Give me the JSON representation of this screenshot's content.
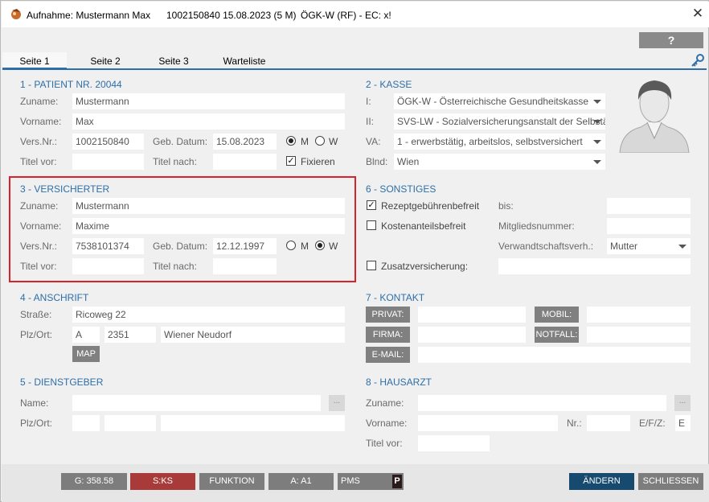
{
  "titlebar": {
    "title": "Aufnahme: Mustermann Max",
    "patient_info": "1002150840 15.08.2023 (5 M)",
    "insurance_info": "ÖGK-W (RF) - EC: x!",
    "close_glyph": "✕"
  },
  "help_label": "?",
  "tabs": [
    "Seite 1",
    "Seite 2",
    "Seite 3",
    "Warteliste"
  ],
  "patient": {
    "heading": "1 - PATIENT NR. 20044",
    "zuname_label": "Zuname:",
    "zuname": "Mustermann",
    "vorname_label": "Vorname:",
    "vorname": "Max",
    "versnr_label": "Vers.Nr.:",
    "versnr": "1002150840",
    "gebdatum_label": "Geb. Datum:",
    "gebdatum": "15.08.2023",
    "m_label": "M",
    "w_label": "W",
    "sex": "M",
    "titelvor_label": "Titel vor:",
    "titelnach_label": "Titel nach:",
    "fixieren_label": "Fixieren",
    "fixieren": true
  },
  "kasse": {
    "heading": "2 - KASSE",
    "i_label": "I:",
    "i_value": "ÖGK-W - Österreichische Gesundheitskasse",
    "ii_label": "II:",
    "ii_value": "SVS-LW - Sozialversicherungsanstalt der Selbständigen",
    "va_label": "VA:",
    "va_value": "1 - erwerbstätig, arbeitslos, selbstversichert",
    "blnd_label": "Blnd:",
    "blnd_value": "Wien"
  },
  "versicherter": {
    "heading": "3 - VERSICHERTER",
    "zuname_label": "Zuname:",
    "zuname": "Mustermann",
    "vorname_label": "Vorname:",
    "vorname": "Maxime",
    "versnr_label": "Vers.Nr.:",
    "versnr": "7538101374",
    "gebdatum_label": "Geb. Datum:",
    "gebdatum": "12.12.1997",
    "m_label": "M",
    "w_label": "W",
    "sex": "W",
    "titelvor_label": "Titel vor:",
    "titelnach_label": "Titel nach:"
  },
  "sonstiges": {
    "heading": "6 - SONSTIGES",
    "rezept_label": "Rezeptgebührenbefreit",
    "rezept": true,
    "bis_label": "bis:",
    "kosten_label": "Kostenanteilsbefreit",
    "kosten": false,
    "mitglied_label": "Mitgliedsnummer:",
    "verwandt_label": "Verwandtschaftsverh.:",
    "verwandt_value": "Mutter",
    "zusatz_label": "Zusatzversicherung:",
    "zusatz": false
  },
  "anschrift": {
    "heading": "4 - ANSCHRIFT",
    "strasse_label": "Straße:",
    "strasse": "Ricoweg 22",
    "plzort_label": "Plz/Ort:",
    "land": "A",
    "plz": "2351",
    "ort": "Wiener Neudorf",
    "map_label": "MAP"
  },
  "kontakt": {
    "heading": "7 - KONTAKT",
    "privat_label": "PRIVAT:",
    "mobil_label": "MOBIL:",
    "firma_label": "FIRMA:",
    "notfall_label": "NOTFALL:",
    "email_label": "E-MAIL:"
  },
  "dienstgeber": {
    "heading": "5 - DIENSTGEBER",
    "name_label": "Name:",
    "plzort_label": "Plz/Ort:",
    "dots": "..."
  },
  "hausarzt": {
    "heading": "8 - HAUSARZT",
    "zuname_label": "Zuname:",
    "vorname_label": "Vorname:",
    "nr_label": "Nr.:",
    "efz_label": "E/F/Z:",
    "efz_value": "E",
    "titelvor_label": "Titel vor:",
    "dots": "..."
  },
  "bottom": {
    "g_label": "G: 358.58",
    "s_label": "S:KS",
    "funktion_label": "FUNKTION",
    "a_label": "A: A1",
    "pms_label": "PMS",
    "p_badge": "P",
    "aendern_label": "ÄNDERN",
    "schliessen_label": "SCHLIESSEN"
  },
  "colors": {
    "accent": "#2e6fa8",
    "highlight": "#d8232a",
    "s_button": "#a83a3a",
    "aendern": "#164a6e"
  },
  "icons": [
    "app-icon",
    "close-icon",
    "key-icon",
    "avatar-icon",
    "dropdown-arrow-icon"
  ]
}
